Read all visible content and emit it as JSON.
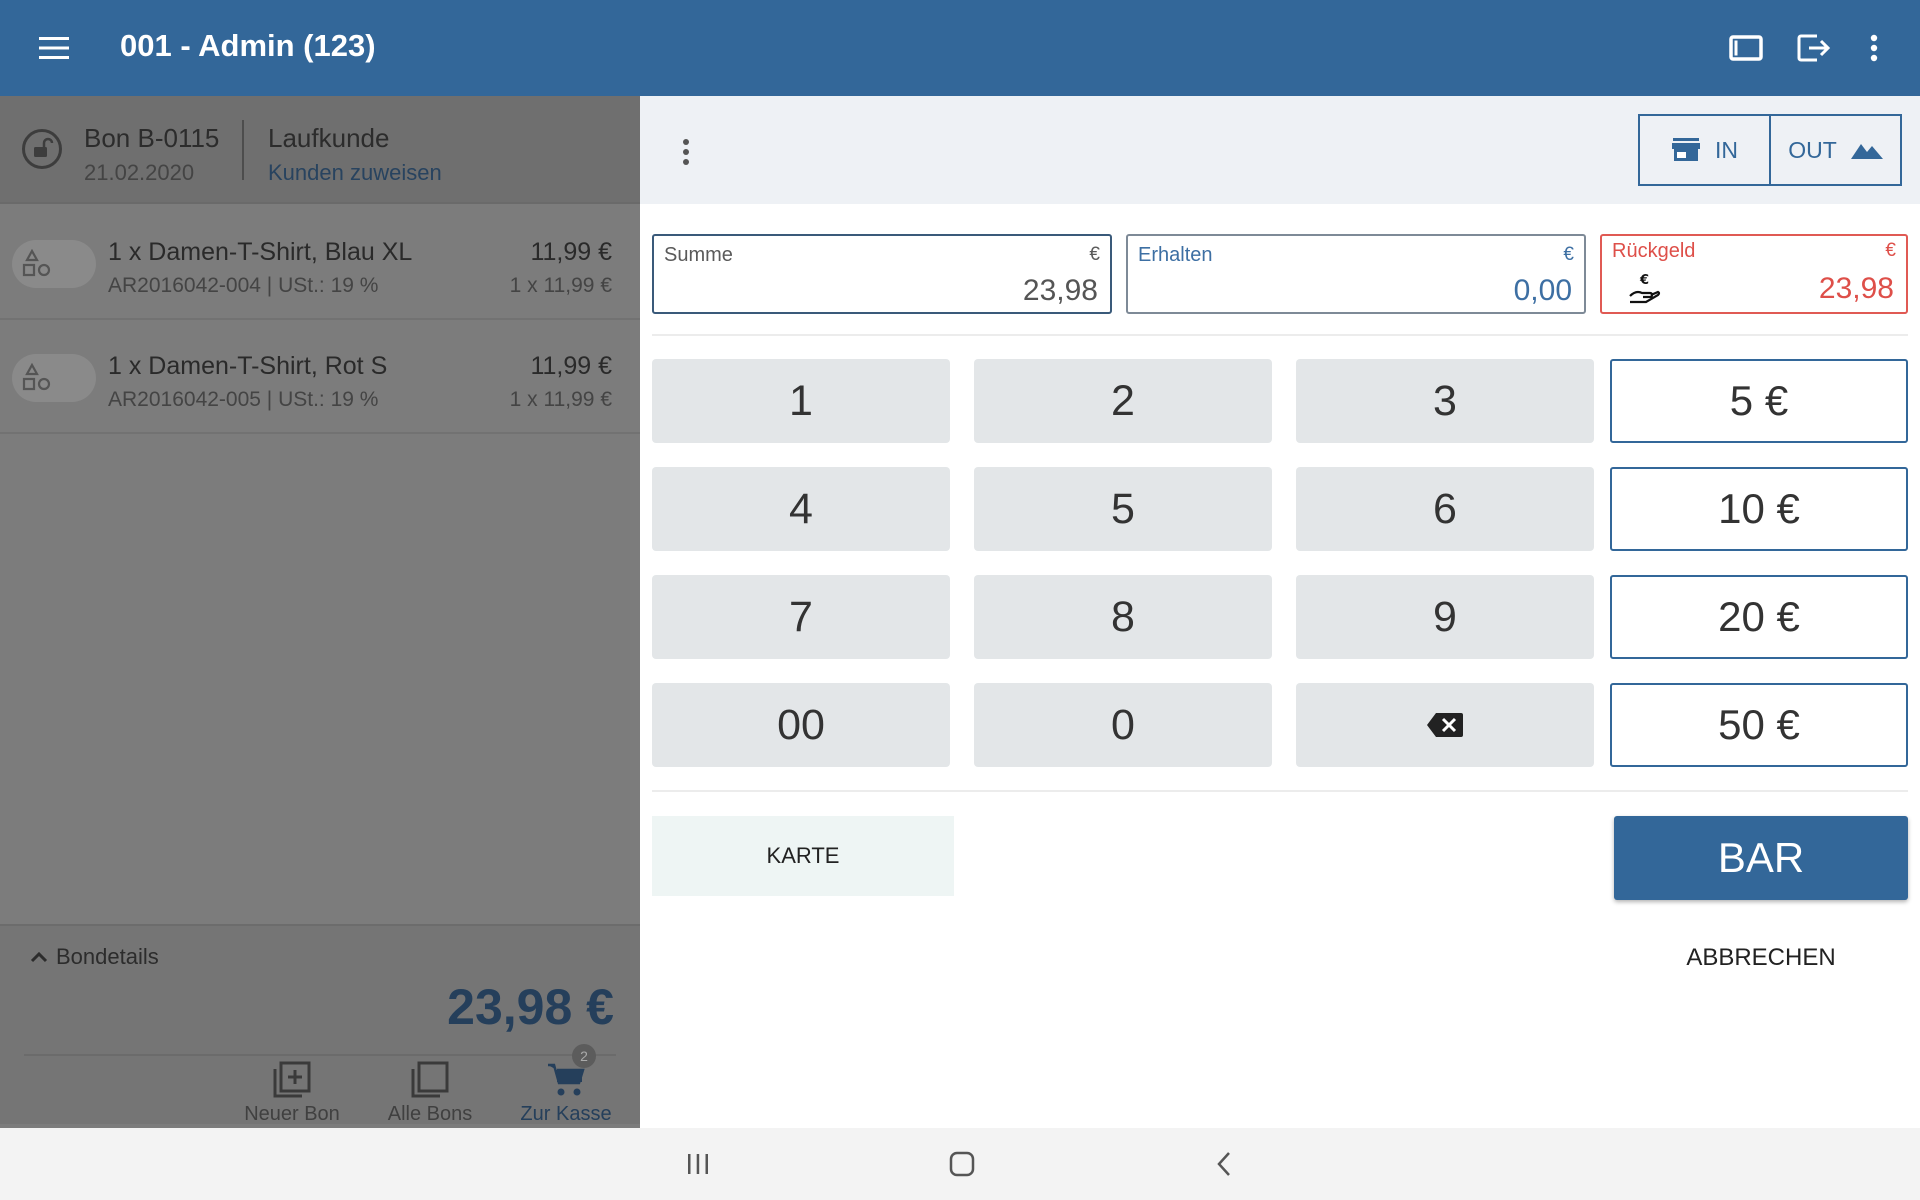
{
  "appbar": {
    "title": "001 - Admin (123)",
    "icons": [
      "menu-icon",
      "tablet-icon",
      "logout-icon",
      "more-vert-icon"
    ]
  },
  "receipt": {
    "bon_number": "Bon B-0115",
    "date": "21.02.2020",
    "customer": "Laufkunde",
    "assign_customer": "Kunden zuweisen",
    "items": [
      {
        "name": "1 x Damen-T-Shirt, Blau XL",
        "sub": "AR2016042-004 | USt.: 19 %",
        "price": "11,99 €",
        "qty": "1 x 11,99 €"
      },
      {
        "name": "1 x Damen-T-Shirt, Rot S",
        "sub": "AR2016042-005 | USt.: 19 %",
        "price": "11,99 €",
        "qty": "1 x 11,99 €"
      }
    ],
    "details_label": "Bondetails",
    "total": "23,98 €"
  },
  "bottom_nav": {
    "new_bon": "Neuer Bon",
    "all_bons": "Alle Bons",
    "checkout": "Zur Kasse",
    "cart_badge": "2"
  },
  "toggle": {
    "in_label": "IN",
    "out_label": "OUT"
  },
  "fields": {
    "sum": {
      "label": "Summe",
      "currency": "€",
      "value": "23,98"
    },
    "received": {
      "label": "Erhalten",
      "currency": "€",
      "value": "0,00"
    },
    "change": {
      "label": "Rückgeld",
      "currency": "€",
      "value": "23,98"
    }
  },
  "keypad": {
    "k1": "1",
    "k2": "2",
    "k3": "3",
    "k4": "4",
    "k5": "5",
    "k6": "6",
    "k7": "7",
    "k8": "8",
    "k9": "9",
    "k00": "00",
    "k0": "0"
  },
  "quick_amounts": [
    "5 €",
    "10 €",
    "20 €",
    "50 €"
  ],
  "actions": {
    "card": "KARTE",
    "cash": "BAR",
    "cancel": "ABBRECHEN"
  },
  "colors": {
    "primary": "#336799",
    "change_red": "#de4f49",
    "received_blue": "#3d6fa3"
  }
}
